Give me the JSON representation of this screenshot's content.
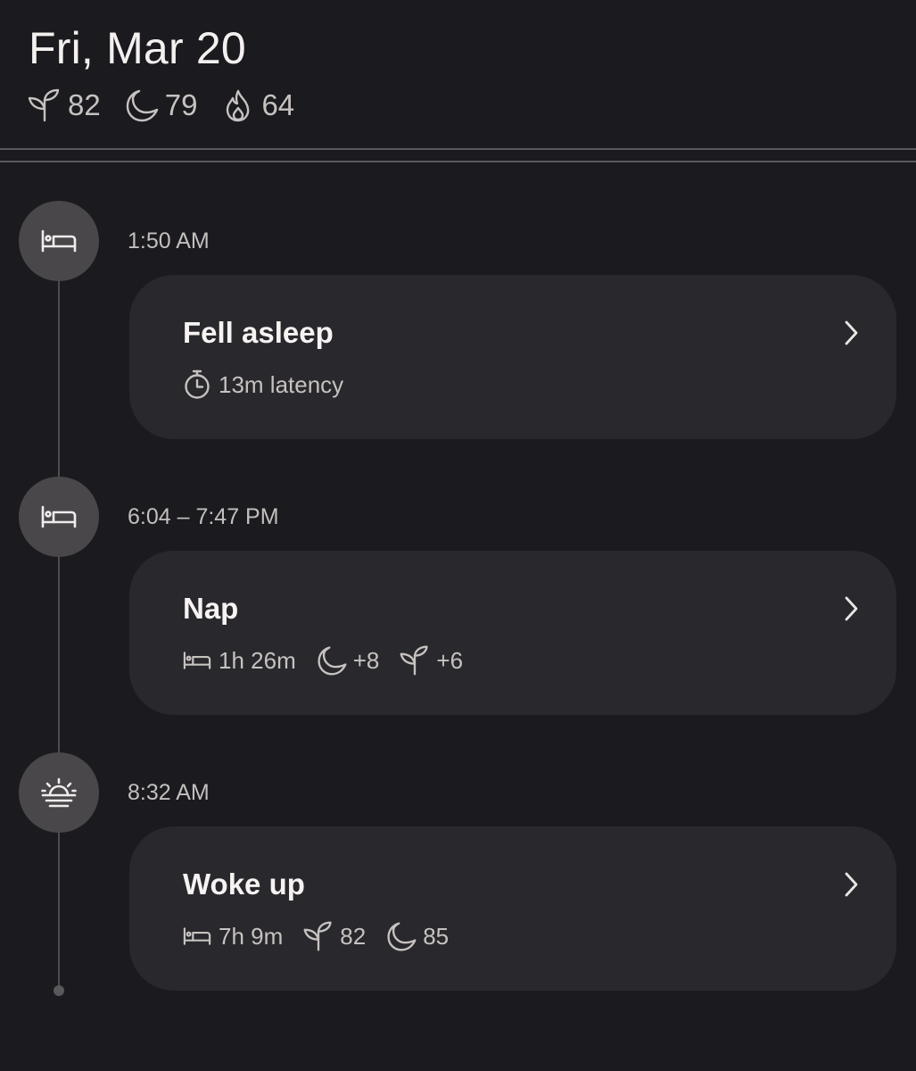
{
  "header": {
    "date": "Fri, Mar 20",
    "scores": [
      {
        "icon": "sprout-icon",
        "value": "82"
      },
      {
        "icon": "moon-icon",
        "value": "79"
      },
      {
        "icon": "flame-icon",
        "value": "64"
      }
    ]
  },
  "events": [
    {
      "node_icon": "bed-icon",
      "time": "1:50 AM",
      "title": "Fell asleep",
      "metrics": [
        {
          "icon": "stopwatch-icon",
          "value": "13m latency"
        }
      ]
    },
    {
      "node_icon": "bed-icon",
      "time": "6:04 – 7:47 PM",
      "title": "Nap",
      "metrics": [
        {
          "icon": "bed-icon",
          "value": "1h 26m"
        },
        {
          "icon": "moon-icon",
          "value": "+8"
        },
        {
          "icon": "sprout-icon",
          "value": "+6"
        }
      ]
    },
    {
      "node_icon": "sunrise-icon",
      "time": "8:32 AM",
      "title": "Woke up",
      "metrics": [
        {
          "icon": "bed-icon",
          "value": "7h 9m"
        },
        {
          "icon": "sprout-icon",
          "value": "82"
        },
        {
          "icon": "moon-icon",
          "value": "85"
        }
      ]
    }
  ],
  "colors": {
    "background": "#1b1a1e",
    "card": "#29282c",
    "node": "#49474a",
    "text_primary": "#f3f0ef",
    "text_secondary": "#c6c2c0"
  }
}
